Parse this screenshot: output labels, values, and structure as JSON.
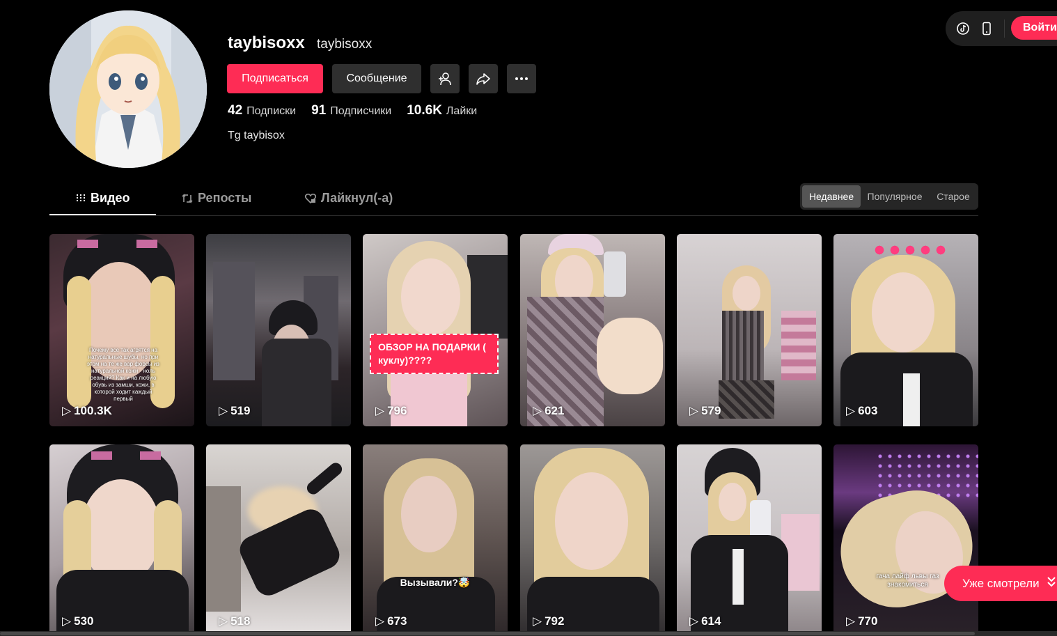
{
  "header": {
    "login_label": "Войти",
    "icons": [
      "tiktok-logo-icon",
      "mobile-icon"
    ]
  },
  "profile": {
    "username": "taybisoxx",
    "nickname": "taybisoxx",
    "follow_label": "Подписаться",
    "message_label": "Сообщение",
    "stats": {
      "following_count": "42",
      "following_label": "Подписки",
      "followers_count": "91",
      "followers_label": "Подписчики",
      "likes_count": "10.6K",
      "likes_label": "Лайки"
    },
    "bio": "Tg taybisox"
  },
  "tabs": [
    {
      "label": "Видео",
      "active": true
    },
    {
      "label": "Репосты",
      "active": false
    },
    {
      "label": "Лайкнул(-а)",
      "active": false
    }
  ],
  "sort": {
    "options": [
      "Недавнее",
      "Популярное",
      "Старое"
    ],
    "selected": "Недавнее"
  },
  "videos": [
    {
      "views": "100.3K",
      "caption": "Почему все так агрятся на натуральные шубы, но при этом на те же вар форсы из натуральной кожи - ноль реакций? Как и на любую обувь из замши, кожи, в которой ходит каждый первый"
    },
    {
      "views": "519"
    },
    {
      "views": "796",
      "caption": "ОБЗОР НА ПОДАРКИ ( куклу)????"
    },
    {
      "views": "621"
    },
    {
      "views": "579"
    },
    {
      "views": "603"
    },
    {
      "views": "530"
    },
    {
      "views": "518"
    },
    {
      "views": "673",
      "caption": "Вызывали?🤯"
    },
    {
      "views": "792"
    },
    {
      "views": "614"
    },
    {
      "views": "770",
      "caption": "гача лайф львы газ знакомиться"
    }
  ],
  "watched_label": "Уже смотрели",
  "colors": {
    "accent": "#fe2c55",
    "background": "#000000",
    "button_dark": "#2f2f2f"
  }
}
